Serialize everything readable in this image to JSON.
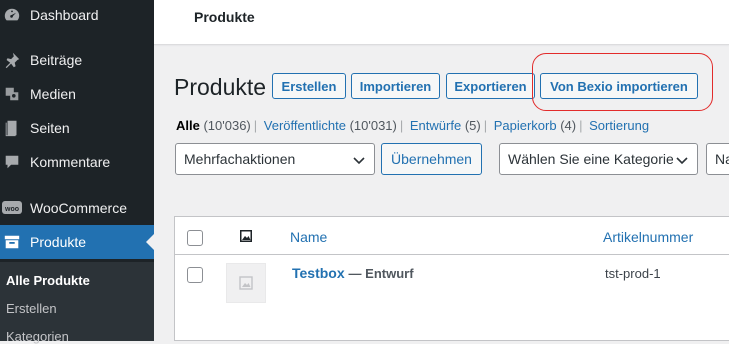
{
  "sidebar": {
    "items": [
      {
        "label": "Dashboard",
        "icon": "dashboard-icon"
      },
      {
        "label": "Beiträge",
        "icon": "pin-icon"
      },
      {
        "label": "Medien",
        "icon": "media-icon"
      },
      {
        "label": "Seiten",
        "icon": "page-icon"
      },
      {
        "label": "Kommentare",
        "icon": "comment-icon"
      },
      {
        "label": "WooCommerce",
        "icon": "woo-icon"
      },
      {
        "label": "Produkte",
        "icon": "archive-icon"
      }
    ],
    "submenu": [
      "Alle Produkte",
      "Erstellen",
      "Kategorien"
    ]
  },
  "topbar": {
    "title": "Produkte"
  },
  "page": {
    "title": "Produkte",
    "buttons": {
      "create": "Erstellen",
      "import": "Importieren",
      "export": "Exportieren",
      "bexio": "Von Bexio importieren"
    }
  },
  "filters": {
    "all": "Alle",
    "all_count": "(10'036)",
    "published": "Veröffentlichte",
    "published_count": "(10'031)",
    "drafts": "Entwürfe",
    "drafts_count": "(5)",
    "trash": "Papierkorb",
    "trash_count": "(4)",
    "sorting": "Sortierung"
  },
  "toolbar": {
    "bulk_selected": "Mehrfachaktionen",
    "apply": "Übernehmen",
    "category_selected": "Wählen Sie eine Kategorie",
    "next_selected": "Na"
  },
  "table": {
    "headers": {
      "name": "Name",
      "sku": "Artikelnummer"
    },
    "rows": [
      {
        "name": "Testbox",
        "status": "— Entwurf",
        "sku": "tst-prod-1"
      }
    ]
  },
  "colors": {
    "accent": "#2271b1",
    "sidebar_bg": "#1d2327",
    "highlight": "#e22b2b"
  }
}
